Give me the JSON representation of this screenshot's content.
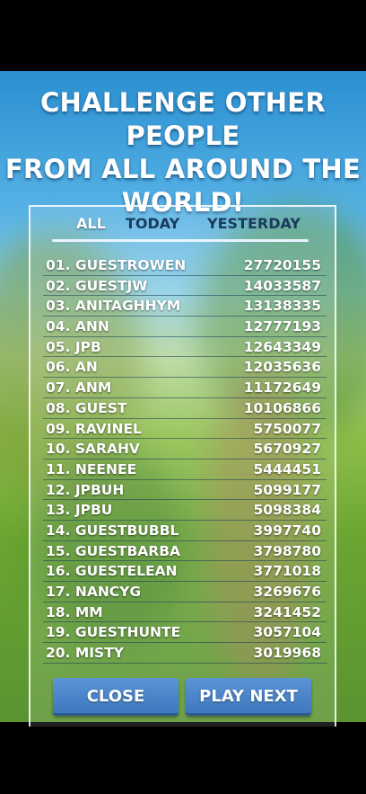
{
  "headline": {
    "line1": "CHALLENGE OTHER PEOPLE",
    "line2": "FROM ALL AROUND THE",
    "line3": "WORLD!"
  },
  "tabs": [
    {
      "label": "ALL",
      "active": true
    },
    {
      "label": "TODAY",
      "active": false
    },
    {
      "label": "YESTERDAY",
      "active": false
    }
  ],
  "leaderboard": [
    {
      "rank": "01.",
      "name": "GUESTROWEN",
      "score": "27720155"
    },
    {
      "rank": "02.",
      "name": "GUESTJW",
      "score": "14033587"
    },
    {
      "rank": "03.",
      "name": "ANITAGHHYM",
      "score": "13138335"
    },
    {
      "rank": "04.",
      "name": "ANN",
      "score": "12777193"
    },
    {
      "rank": "05.",
      "name": "JPB",
      "score": "12643349"
    },
    {
      "rank": "06.",
      "name": "AN",
      "score": "12035636"
    },
    {
      "rank": "07.",
      "name": "ANM",
      "score": "11172649"
    },
    {
      "rank": "08.",
      "name": "GUEST",
      "score": "10106866"
    },
    {
      "rank": "09.",
      "name": "RAVINEL",
      "score": "5750077"
    },
    {
      "rank": "10.",
      "name": "SARAHV",
      "score": "5670927"
    },
    {
      "rank": "11.",
      "name": "NEENEE",
      "score": "5444451"
    },
    {
      "rank": "12.",
      "name": "JPBUH",
      "score": "5099177"
    },
    {
      "rank": "13.",
      "name": "JPBU",
      "score": "5098384"
    },
    {
      "rank": "14.",
      "name": "GUESTBUBBL",
      "score": "3997740"
    },
    {
      "rank": "15.",
      "name": "GUESTBARBA",
      "score": "3798780"
    },
    {
      "rank": "16.",
      "name": "GUESTELEAN",
      "score": "3771018"
    },
    {
      "rank": "17.",
      "name": "NANCYG",
      "score": "3269676"
    },
    {
      "rank": "18.",
      "name": "MM",
      "score": "3241452"
    },
    {
      "rank": "19.",
      "name": "GUESTHUNTE",
      "score": "3057104"
    },
    {
      "rank": "20.",
      "name": "MISTY",
      "score": "3019968"
    }
  ],
  "buttons": {
    "close_label": "CLOSE",
    "play_next_label": "PLAY NEXT"
  }
}
